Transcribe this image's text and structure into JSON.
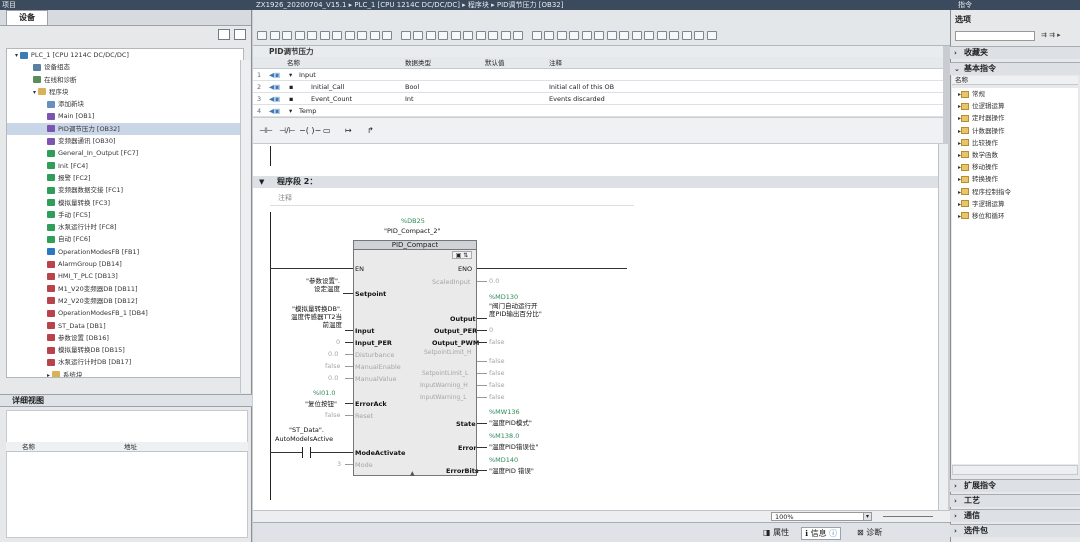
{
  "titlebar": {
    "left": "项目",
    "title": "ZX1926_20200704_V15.1 ▸ PLC_1 [CPU 1214C DC/DC/DC] ▸ 程序块 ▸ PID调节压力 [OB32]",
    "right": "指令"
  },
  "devices": {
    "tab": "设备",
    "tree": [
      {
        "label": "PLC_1 [CPU 1214C DC/DC/DC]",
        "color": "#3d7ab8"
      },
      {
        "label": "设备组态",
        "color": "#5b7fa3"
      },
      {
        "label": "在线和诊断",
        "color": "#5b8c5b"
      },
      {
        "label": "程序块",
        "color": "#d8b25a"
      },
      {
        "label": "添加新块",
        "color": "#6a8fbf"
      },
      {
        "label": "Main [OB1]",
        "color": "#7b55b0"
      },
      {
        "label": "PID调节压力 [OB32]",
        "color": "#7b55b0"
      },
      {
        "label": "变频器通讯 [OB30]",
        "color": "#7b55b0"
      },
      {
        "label": "General_In_Output [FC7]",
        "color": "#2f9e58"
      },
      {
        "label": "Init [FC4]",
        "color": "#2f9e58"
      },
      {
        "label": "报警 [FC2]",
        "color": "#2f9e58"
      },
      {
        "label": "变频器数据交接 [FC1]",
        "color": "#2f9e58"
      },
      {
        "label": "模拟量转换 [FC3]",
        "color": "#2f9e58"
      },
      {
        "label": "手动 [FC5]",
        "color": "#2f9e58"
      },
      {
        "label": "水泵运行计时 [FC8]",
        "color": "#2f9e58"
      },
      {
        "label": "自动 [FC6]",
        "color": "#2f9e58"
      },
      {
        "label": "OperationModesFB [FB1]",
        "color": "#2a78c2"
      },
      {
        "label": "AlarmGroup [DB14]",
        "color": "#b8434b"
      },
      {
        "label": "HMI_T_PLC [DB13]",
        "color": "#b8434b"
      },
      {
        "label": "M1_V20变频器DB [DB11]",
        "color": "#b8434b"
      },
      {
        "label": "M2_V20变频器DB [DB12]",
        "color": "#b8434b"
      },
      {
        "label": "OperationModesFB_1 [DB4]",
        "color": "#b8434b"
      },
      {
        "label": "ST_Data [DB1]",
        "color": "#b8434b"
      },
      {
        "label": "参数设置 [DB16]",
        "color": "#b8434b"
      },
      {
        "label": "模拟量转换DB [DB15]",
        "color": "#b8434b"
      },
      {
        "label": "水泵运行计时DB [DB17]",
        "color": "#b8434b"
      },
      {
        "label": "系统块",
        "color": "#d8b25a"
      }
    ],
    "detail_title": "详细视图",
    "col_name": "名称",
    "col_addr": "地址"
  },
  "editor": {
    "block_title": "PID调节压力",
    "interface": {
      "headers": [
        "名称",
        "数据类型",
        "默认值",
        "注释"
      ],
      "rows": [
        {
          "num": "1",
          "name": "Input",
          "type": "",
          "default": "",
          "comment": ""
        },
        {
          "num": "2",
          "name": "Initial_Call",
          "type": "Bool",
          "default": "",
          "comment": "Initial call of this OB"
        },
        {
          "num": "3",
          "name": "Event_Count",
          "type": "Int",
          "default": "",
          "comment": "Events discarded"
        },
        {
          "num": "4",
          "name": "Temp",
          "type": "",
          "default": "",
          "comment": ""
        }
      ]
    },
    "ladder_symbols": [
      "⊣⊢",
      "⊣/⊢",
      "−( )−",
      "▭",
      "↦",
      "↱"
    ],
    "network": {
      "title": "程序段 2：",
      "comment": "注释"
    },
    "fb": {
      "instance_addr": "%DB25",
      "instance_name": "\"PID_Compact_2\"",
      "name": "PID_Compact",
      "in_pins": [
        "EN",
        "Setpoint",
        "Input",
        "Input_PER",
        "Disturbance",
        "ManualEnable",
        "ManualValue",
        "ErrorAck",
        "Reset",
        "ModeActivate",
        "Mode"
      ],
      "out_pins": [
        "ENO",
        "ScaledInput",
        "Output",
        "Output_PER",
        "Output_PWM",
        "SetpointLimit_H",
        "SetpointLimit_L",
        "InputWarning_H",
        "InputWarning_L",
        "State",
        "Error",
        "ErrorBits"
      ],
      "in_labels": {
        "setpoint": "\"参数设置\".\n设定温度",
        "input": "\"模拟量转换DB\".\n温度传感器TT2当\n前温度",
        "input_per": "0",
        "disturbance": "0.0",
        "manual_enable": "false",
        "manual_value": "0.0",
        "erroracka": "%I01.0",
        "errorackb": "\"复位按钮\"",
        "reset": "false",
        "mode_a": "\"ST_Data\".",
        "mode_b": "AutoModelsActive",
        "mode": "3"
      },
      "out_labels": {
        "scaled": "0.0",
        "output_addr": "%MD130",
        "output_name": "\"阀门自动运行开\n度PID输出百分比\"",
        "output_per": "0",
        "pwm": "false",
        "spl_h": "false",
        "spl_l": "false",
        "iw_h": "false",
        "iw_l": "false",
        "state_addr": "%MW136",
        "state_name": "\"温度PID模式\"",
        "error_addr": "%M138.0",
        "error_name": "\"温度PID错误位\"",
        "errbits_addr": "%MD140",
        "errbits_name": "\"温度PID 错误\""
      }
    },
    "zoom": "100%",
    "status": {
      "props": "属性",
      "info": "信息",
      "diag": "诊断"
    }
  },
  "instructions": {
    "options": "选项",
    "favorites": "收藏夹",
    "basic": "基本指令",
    "col_name": "名称",
    "items": [
      "常规",
      "位逻辑运算",
      "定时器操作",
      "计数器操作",
      "比较操作",
      "数学函数",
      "移动操作",
      "转换操作",
      "程序控制指令",
      "字逻辑运算",
      "移位和循环"
    ],
    "extended": "扩展指令",
    "tech": "工艺",
    "comm": "通信",
    "options_pkg": "选件包"
  }
}
